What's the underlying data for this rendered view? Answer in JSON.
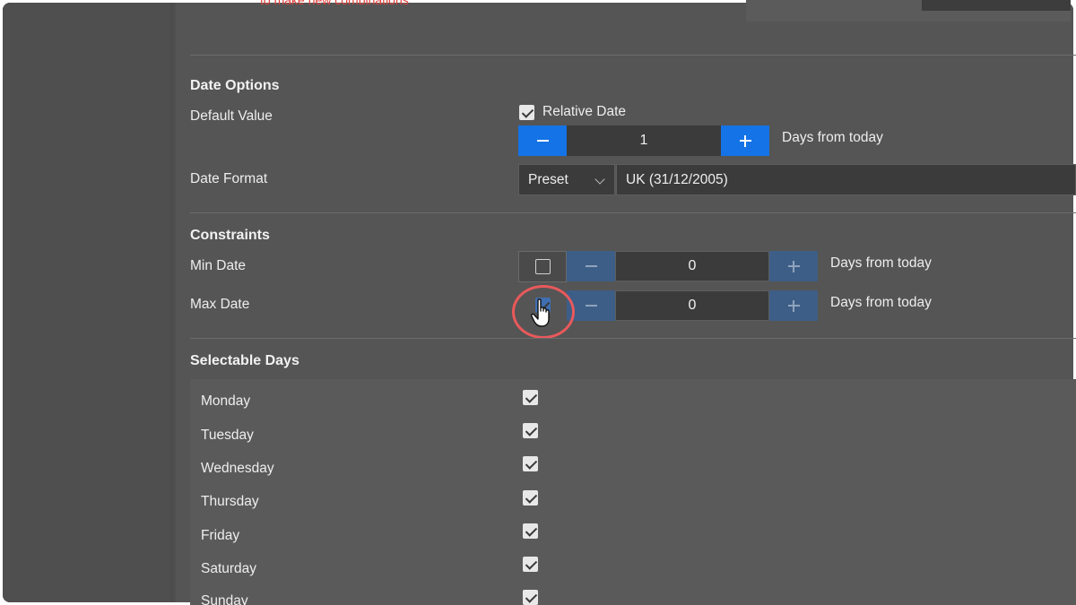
{
  "top": {
    "warning_text": "to make new combinations"
  },
  "date_options": {
    "title": "Date Options",
    "default_value_label": "Default Value",
    "relative_date_label": "Relative Date",
    "relative_date_checked": true,
    "default_value": "1",
    "default_suffix": "Days from today",
    "date_format_label": "Date Format",
    "date_format_mode": "Preset",
    "date_format_value": "UK (31/12/2005)"
  },
  "constraints": {
    "title": "Constraints",
    "min_label": "Min Date",
    "min_checked": false,
    "min_value": "0",
    "min_suffix": "Days from today",
    "max_label": "Max Date",
    "max_checked": true,
    "max_value": "0",
    "max_suffix": "Days from today"
  },
  "selectable_days": {
    "title": "Selectable Days",
    "days": [
      {
        "label": "Monday",
        "checked": true
      },
      {
        "label": "Tuesday",
        "checked": true
      },
      {
        "label": "Wednesday",
        "checked": true
      },
      {
        "label": "Thursday",
        "checked": true
      },
      {
        "label": "Friday",
        "checked": true
      },
      {
        "label": "Saturday",
        "checked": true
      },
      {
        "label": "Sunday",
        "checked": true
      }
    ]
  },
  "colors": {
    "accent": "#1473e6",
    "accent_disabled": "#3d5e86",
    "highlight": "#e9595b",
    "warning": "#e0413c"
  },
  "icons": {
    "minus": "minus-icon",
    "plus": "plus-icon",
    "chevron": "chevron-down-icon",
    "cursor": "hand-pointer-icon"
  }
}
